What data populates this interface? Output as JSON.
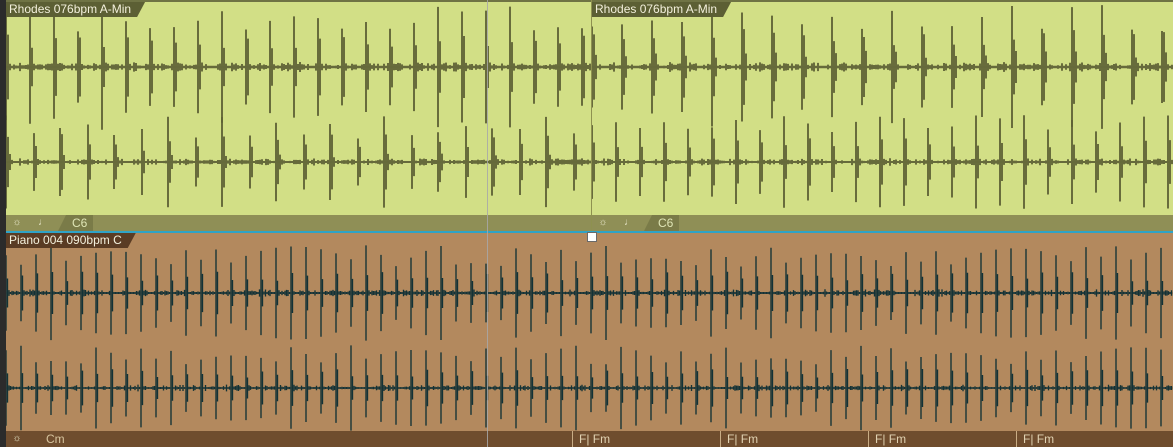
{
  "tracks": [
    {
      "name": "rhodes",
      "color": "#d2df86",
      "wave_color": "#5c5f34",
      "clips": [
        {
          "title": "Rhodes 076bpm A-Min",
          "root_key": "C6"
        },
        {
          "title": "Rhodes 076bpm A-Min",
          "root_key": "C6"
        }
      ],
      "footer_icons": [
        "settings-icon",
        "quantize-icon"
      ]
    },
    {
      "name": "piano",
      "color": "#b3895e",
      "wave_color": "#133236",
      "clips": [
        {
          "title": "Piano 004 090bpm C",
          "chord": "Cm"
        }
      ],
      "chord_markers": [
        {
          "label": "F",
          "chord": "Fm"
        },
        {
          "label": "F",
          "chord": "Fm"
        },
        {
          "label": "F",
          "chord": "Fm"
        },
        {
          "label": "F",
          "chord": "Fm"
        }
      ],
      "footer_icons": [
        "settings-icon"
      ]
    }
  ],
  "icons": {
    "settings": "☼",
    "quantize": "♩"
  }
}
